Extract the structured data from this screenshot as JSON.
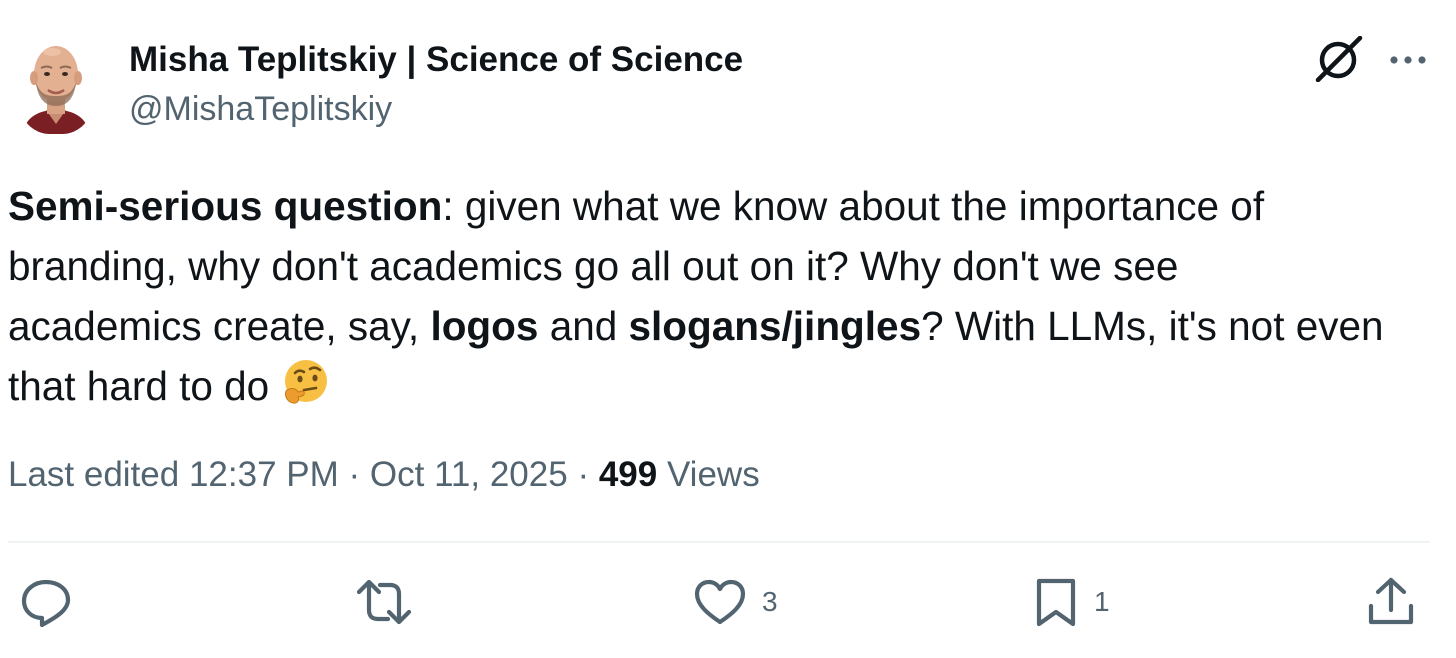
{
  "author": {
    "display_name": "Misha Teplitskiy | Science of Science",
    "handle": "@MishaTeplitskiy",
    "avatar_icon": "profile-photo"
  },
  "header_actions": {
    "grok_icon": "grok-icon",
    "more_icon": "more-dots-icon"
  },
  "tweet": {
    "line1": {
      "bold": "Semi-serious question",
      "rest": ": given what we know about the importance of"
    },
    "line2": "branding, why don't academics go all out on it? Why don't we see",
    "line3": {
      "part1": "academics create, say, ",
      "bold1": "logos",
      "part2": " and ",
      "bold2": "slogans/jingles",
      "part3": "? With LLMs, it's not even"
    },
    "line4": "that hard to do ",
    "emoji": "thinking-face"
  },
  "meta": {
    "edited_label": "Last edited 12:37 PM",
    "separator": " · ",
    "date": "Oct 11, 2025",
    "views_count": "499",
    "views_label": " Views"
  },
  "actions": {
    "reply": {
      "icon": "reply-icon",
      "count": ""
    },
    "retweet": {
      "icon": "retweet-icon",
      "count": ""
    },
    "like": {
      "icon": "heart-icon",
      "count": "3"
    },
    "bookmark": {
      "icon": "bookmark-icon",
      "count": "1"
    },
    "share": {
      "icon": "share-icon"
    }
  },
  "colors": {
    "text_primary": "#0f1419",
    "text_secondary": "#536471",
    "divider": "#eff3f4"
  }
}
